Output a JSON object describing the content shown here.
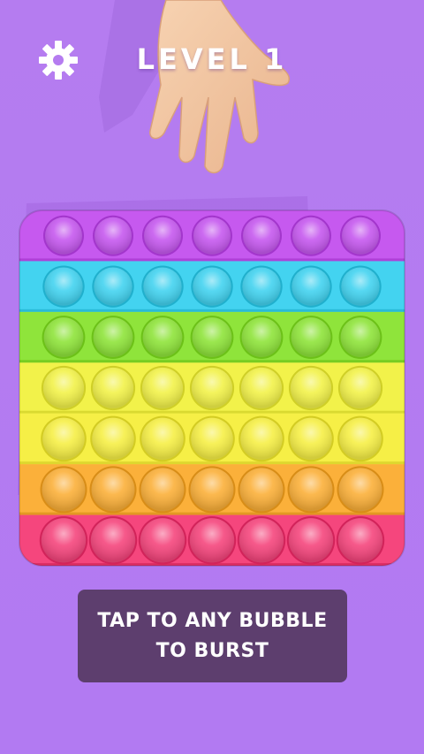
{
  "hud": {
    "level_label": "LEVEL 1",
    "settings_icon": "gear-icon"
  },
  "popit_board": {
    "rows": 7,
    "columns": 7,
    "row_colors": [
      "#c659ef",
      "#43d3f0",
      "#8fe43b",
      "#f2f24a",
      "#f6ef46",
      "#fbb03a",
      "#f5467d"
    ]
  },
  "hint": {
    "line1": "TAP TO ANY BUBBLE",
    "line2": "TO BURST"
  }
}
